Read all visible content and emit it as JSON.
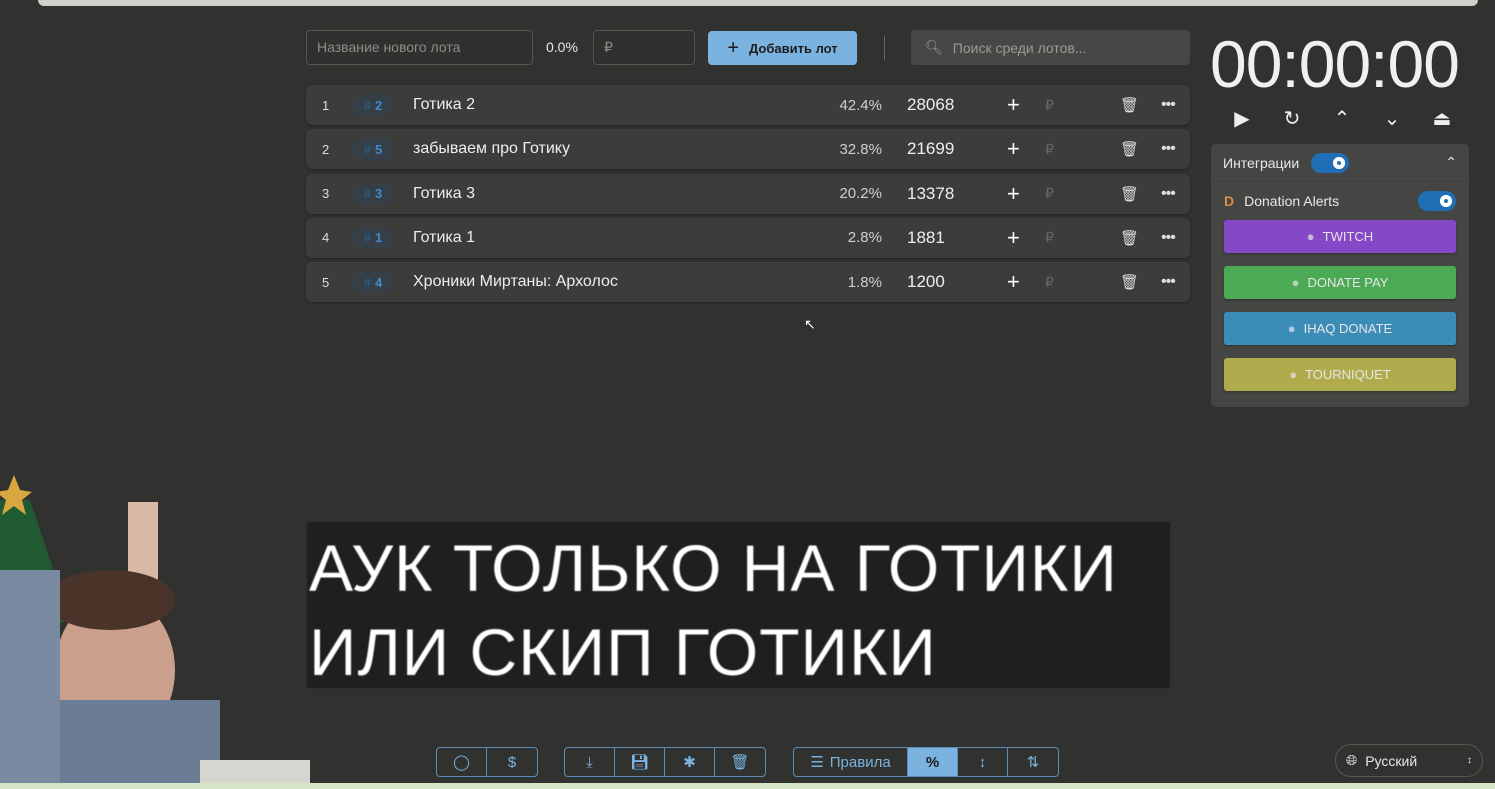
{
  "new_lot": {
    "name_placeholder": "Название нового лота",
    "percent": "0.0%",
    "amount_placeholder": "₽",
    "add_label": "Добавить лот"
  },
  "search": {
    "placeholder": "Поиск среди лотов..."
  },
  "lots": [
    {
      "n": "1",
      "id": "2",
      "name": "Готика 2",
      "pct": "42.4%",
      "amount": "28068"
    },
    {
      "n": "2",
      "id": "5",
      "name": "забываем про Готику",
      "pct": "32.8%",
      "amount": "21699"
    },
    {
      "n": "3",
      "id": "3",
      "name": "Готика 3",
      "pct": "20.2%",
      "amount": "13378"
    },
    {
      "n": "4",
      "id": "1",
      "name": "Готика 1",
      "pct": "2.8%",
      "amount": "1881"
    },
    {
      "n": "5",
      "id": "4",
      "name": "Хроники Миртаны: Архолос",
      "pct": "1.8%",
      "amount": "1200"
    }
  ],
  "currency": "₽",
  "timer": "00:00:00",
  "integrations": {
    "title": "Интеграции",
    "donation_alerts": "Donation Alerts",
    "buttons": [
      {
        "label": "TWITCH",
        "color": "#8548c6"
      },
      {
        "label": "DONATE PAY",
        "color": "#4caa55"
      },
      {
        "label": "IHAQ DONATE",
        "color": "#3b8db8"
      },
      {
        "label": "TOURNIQUET",
        "color": "#b0ab4c"
      }
    ]
  },
  "banner": {
    "line1": "АУК ТОЛЬКО НА ГОТИКИ",
    "line2": "ИЛИ СКИП ГОТИКИ"
  },
  "footer": {
    "rules": "Правила",
    "percent": "%",
    "language": "Русский"
  }
}
